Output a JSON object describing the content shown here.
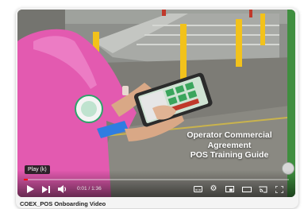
{
  "video": {
    "overlay_title_lines": [
      "Operator Commercial",
      "Agreement",
      "POS Training Guide"
    ],
    "tooltip": "Play (k)",
    "time_current": "0:01",
    "time_separator": " / ",
    "time_total": "1:36",
    "progress": 0.015,
    "caption": "COEX_POS Onboarding Video"
  },
  "controls": {
    "icons": [
      "play-icon",
      "next-icon",
      "volume-icon",
      "subtitles-icon",
      "gear-icon",
      "miniplayer-icon",
      "theater-icon",
      "cast-icon",
      "fullscreen-icon"
    ]
  },
  "colors": {
    "progress": "#ff0000",
    "shirt": "#e35ab0",
    "pillar": "#f2c21b"
  }
}
